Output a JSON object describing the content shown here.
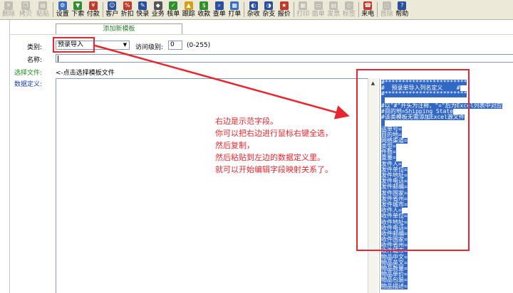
{
  "toolbar": {
    "buttons": [
      {
        "label": "删除",
        "icon": "delete-icon",
        "disabled": true,
        "color": "#8a8a8a"
      },
      {
        "label": "拷贝",
        "icon": "copy-icon",
        "disabled": true,
        "color": "#8a8a8a"
      },
      {
        "label": "粘贴",
        "icon": "paste-icon",
        "disabled": true,
        "color": "#8a8a8a"
      },
      {
        "label": "设置",
        "icon": "settings-icon",
        "disabled": false,
        "color": "#3a6fbf"
      },
      {
        "label": "下索",
        "icon": "download-icon",
        "disabled": false,
        "color": "#2f8f2f"
      },
      {
        "label": "付款",
        "icon": "payment-icon",
        "disabled": false,
        "color": "#c0392b"
      },
      {
        "label": "客户",
        "icon": "customer-icon",
        "disabled": false,
        "color": "#2a4f9c"
      },
      {
        "label": "折扣",
        "icon": "discount-icon",
        "disabled": false,
        "color": "#c0392b"
      },
      {
        "label": "快录",
        "icon": "quick-entry-icon",
        "disabled": false,
        "color": "#2a4f9c"
      },
      {
        "label": "业务",
        "icon": "business-icon",
        "disabled": false,
        "color": "#555555"
      },
      {
        "label": "核单",
        "icon": "verify-icon",
        "disabled": false,
        "color": "#2f8f2f"
      },
      {
        "label": "跟踪",
        "icon": "track-icon",
        "disabled": false,
        "color": "#d4a017"
      },
      {
        "label": "收款",
        "icon": "receipt-icon",
        "disabled": false,
        "color": "#2f8f2f"
      },
      {
        "label": "查单",
        "icon": "search-order-icon",
        "disabled": false,
        "color": "#2a4f9c"
      },
      {
        "label": "打单",
        "icon": "print-order-icon",
        "disabled": false,
        "color": "#3a6fbf"
      },
      {
        "label": "杂收",
        "icon": "misc-receive-icon",
        "disabled": false,
        "color": "#2a4f9c"
      },
      {
        "label": "杂支",
        "icon": "misc-pay-icon",
        "disabled": false,
        "color": "#2a4f9c"
      },
      {
        "label": "报价",
        "icon": "quote-icon",
        "disabled": false,
        "color": "#c0392b"
      },
      {
        "label": "打印",
        "icon": "print-icon",
        "disabled": true,
        "color": "#8a8a8a"
      },
      {
        "label": "面单",
        "icon": "waybill-icon",
        "disabled": true,
        "color": "#8a8a8a"
      },
      {
        "label": "发票",
        "icon": "invoice-icon",
        "disabled": true,
        "color": "#8a8a8a"
      },
      {
        "label": "标签",
        "icon": "label-icon",
        "disabled": true,
        "color": "#8a8a8a"
      },
      {
        "label": "来电",
        "icon": "incoming-call-icon",
        "disabled": false,
        "color": "#c0392b"
      },
      {
        "label": "首除",
        "icon": "clear-icon",
        "disabled": true,
        "color": "#8a8a8a"
      },
      {
        "label": "帮助",
        "icon": "help-icon",
        "disabled": false,
        "color": "#2a4f9c"
      }
    ]
  },
  "form": {
    "tab_label": "添加新模板",
    "category_label": "类别:",
    "category_value": "预录导入",
    "access_label": "访问级别:",
    "access_value": "0",
    "access_range": "(0-255)",
    "name_label": "名称:",
    "file_label": "选择文件:",
    "file_hint": "<-点击选择模板文件",
    "def_label": "数据定义:"
  },
  "sample": {
    "lines": [
      "#************************",
      "#  预录单导入列名定义    #",
      "#************************",
      "",
      "#以\"#\"开头为注释，\"=\"后为Excel列表中对应",
      "#目的地=Shipping State",
      "#该类模板无需添加Excel源文件",
      "",
      "运单号=",
      "目的地=",
      "网络渠道=",
      "类型=",
      "件数=",
      "重量=",
      "发件人=",
      "发件单位=",
      "发件地址=",
      "发件电话=",
      "发件邮编=",
      "发件国家=",
      "发件省州=",
      "发件城市=",
      "收件人=",
      "收件单位=",
      "收件地址=",
      "收件电话=",
      "收件邮编=",
      "收件国家=",
      "收件省州=",
      "收件城市=",
      "物品中文=",
      "物品英文=",
      "物品数量=",
      "物品单价=",
      "物品包装=",
      "物品描述="
    ]
  },
  "annotation": {
    "lines": [
      "右边是示范字段。",
      "你可以把右边进行鼠标右键全选，",
      "然后复制，",
      "然后粘贴到左边的数据定义里。",
      "就可以开始编辑字段映射关系了。"
    ],
    "color": "#e8262e"
  }
}
